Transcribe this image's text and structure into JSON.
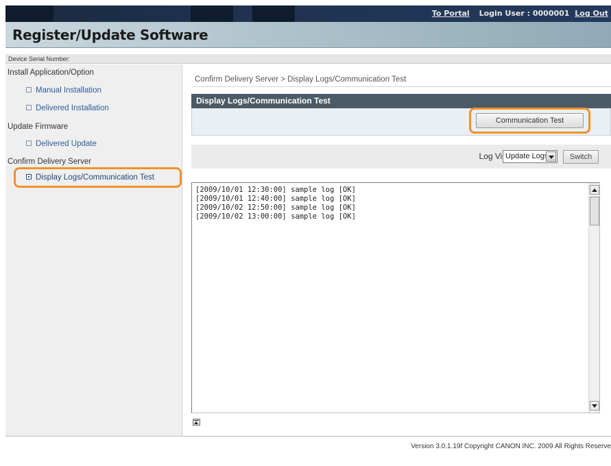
{
  "header": {
    "portal_link": "To Portal",
    "login_user": "Login User : 0000001",
    "logout_link": "Log Out"
  },
  "title": "Register/Update Software",
  "serial_label": "Device Serial Number:",
  "sidebar": {
    "sections": [
      {
        "label": "Install Application/Option"
      },
      {
        "label": "Update Firmware"
      },
      {
        "label": "Confirm Delivery Server"
      }
    ],
    "items": [
      {
        "label": "Manual Installation"
      },
      {
        "label": "Delivered Installation"
      },
      {
        "label": "Delivered Update"
      },
      {
        "label": "Display Logs/Communication Test"
      }
    ]
  },
  "breadcrumb": "Confirm Delivery Server > Display Logs/Communication Test",
  "panel_title": "Display Logs/Communication Test",
  "communication_test_button": "Communication Test",
  "log_view": {
    "label": "Log View:",
    "selected": "Update Logs",
    "switch_button": "Switch"
  },
  "logs": "[2009/10/01 12:30:00] sample log [OK]\n[2009/10/01 12:40:00] sample log [OK]\n[2009/10/02 12:50:00] sample log [OK]\n[2009/10/02 13:00:00] sample log [OK]",
  "footer": "Version 3.0.1.19f Copyright CANON INC. 2009 All Rights Reserve",
  "colors": {
    "highlight": "#f0922c",
    "topbar": "#1f3350",
    "panel_header": "#4a5a66"
  }
}
